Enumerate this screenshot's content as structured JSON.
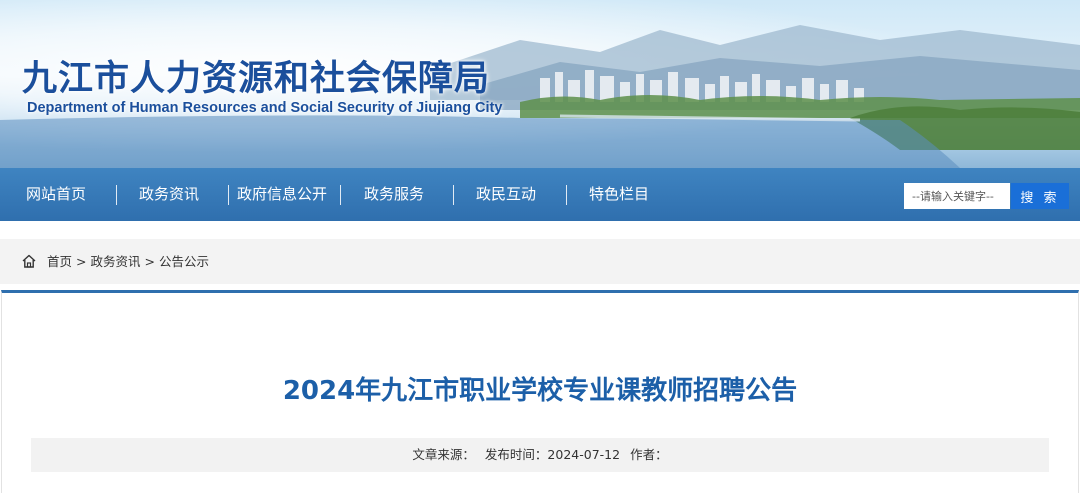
{
  "header": {
    "title_cn": "九江市人力资源和社会保障局",
    "title_en": "Department of Human Resources and Social Security of Jiujiang City"
  },
  "nav": {
    "items": [
      {
        "label": "网站首页"
      },
      {
        "label": "政务资讯"
      },
      {
        "label": "政府信息公开"
      },
      {
        "label": "政务服务"
      },
      {
        "label": "政民互动"
      },
      {
        "label": "特色栏目"
      }
    ]
  },
  "search": {
    "placeholder": "--请输入关键字--",
    "button_label": "搜 索"
  },
  "breadcrumb": {
    "icon": "home-icon",
    "items": [
      "首页",
      "政务资讯",
      "公告公示"
    ],
    "separator": ">"
  },
  "article": {
    "title": "2024年九江市职业学校专业课教师招聘公告",
    "source_label": "文章来源：",
    "date_label": "发布时间：",
    "date": "2024-07-12",
    "author_label": "作者："
  },
  "colors": {
    "brand_blue": "#1b4f9c",
    "nav_blue": "#2f6fae",
    "search_button": "#1a6fd8",
    "title_blue": "#1c5fa8"
  }
}
